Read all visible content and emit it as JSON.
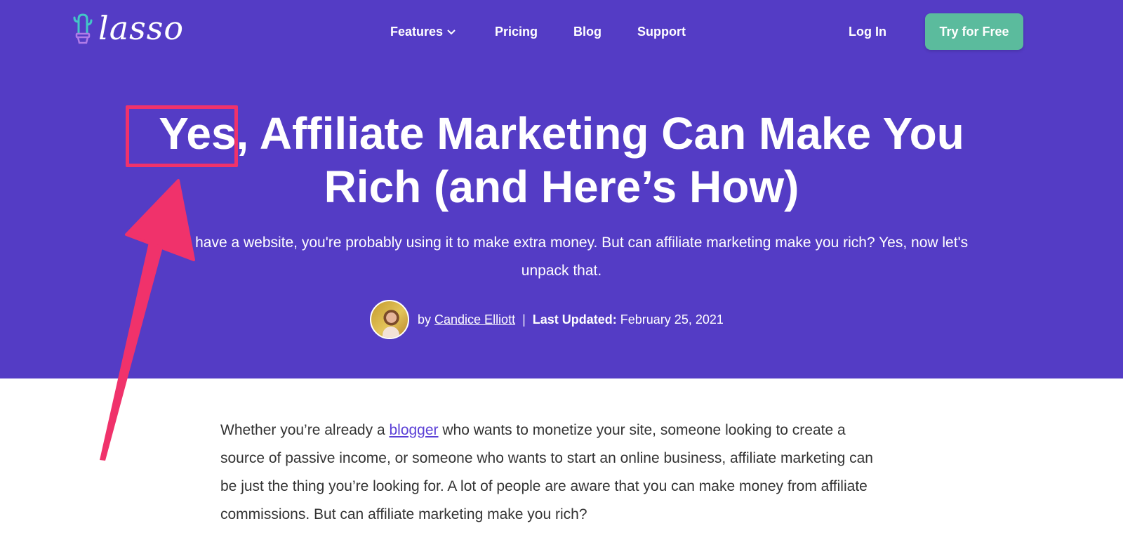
{
  "brand": {
    "name": "lasso"
  },
  "nav": {
    "features": "Features",
    "pricing": "Pricing",
    "blog": "Blog",
    "support": "Support",
    "login": "Log In",
    "cta": "Try for Free"
  },
  "hero": {
    "title_line1_highlight": "Yes,",
    "title_line1_rest": "Affiliate Marketing Can Make You",
    "title_line2": "Rich (and Here’s How)",
    "subtitle_line1": "If you have a website, you're probably using it to make extra money. But can affiliate marketing make you rich? Yes, now let's",
    "subtitle_line2": "unpack that.",
    "byline": {
      "by": "by",
      "author": "Candice Elliott",
      "separator": "|",
      "updated_label": "Last Updated:",
      "updated_date": "February 25, 2021"
    }
  },
  "article": {
    "p1_before": "Whether you’re already a ",
    "p1_link": "blogger",
    "p1_after": " who wants to monetize your site, someone looking to create a source of passive income, or someone who wants to start an online business, affiliate marketing can be just the thing you’re looking for. A lot of people are aware that you can make money from affiliate commissions. But can affiliate marketing make you rich?"
  },
  "colors": {
    "hero_bg": "#543cc5",
    "cta_bg": "#5bbb9d",
    "annotation": "#f0326b",
    "link": "#5a3fd6"
  },
  "icons": {
    "logo": "cactus-pot-icon",
    "features_dropdown": "chevron-down-icon"
  }
}
